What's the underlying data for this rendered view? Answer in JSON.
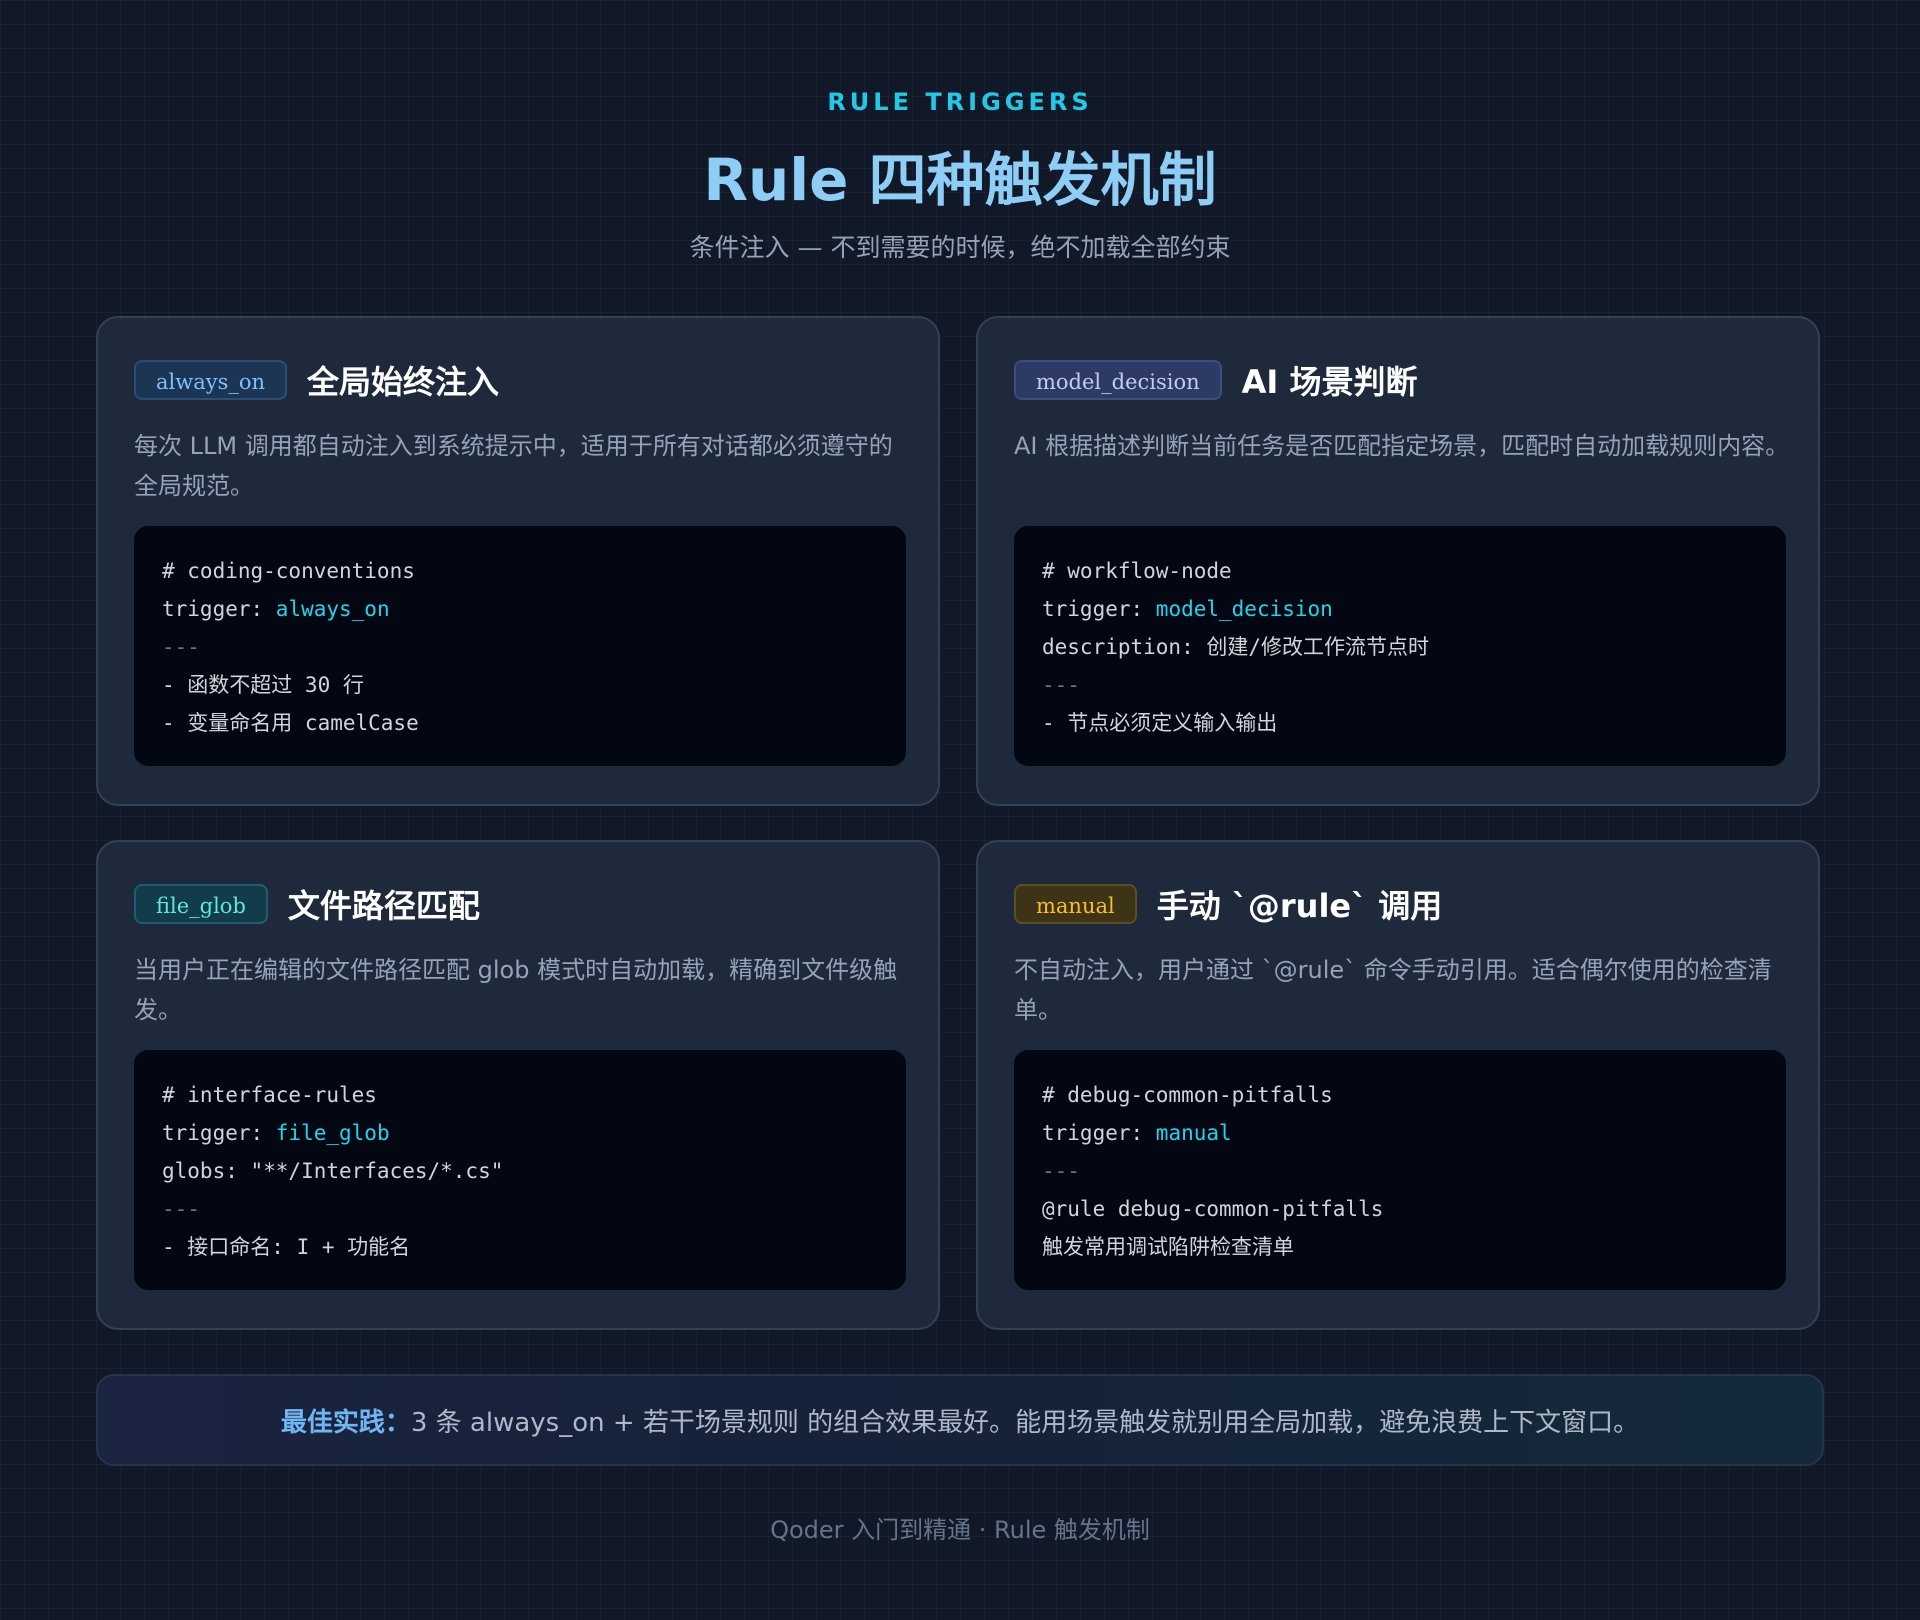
{
  "header": {
    "eyebrow": "RULE TRIGGERS",
    "title": "Rule 四种触发机制",
    "subtitle": "条件注入 — 不到需要的时候，绝不加载全部约束"
  },
  "cards": [
    {
      "tag": "always_on",
      "title": "全局始终注入",
      "desc": "每次 LLM 调用都自动注入到系统提示中，适用于所有对话都必须遵守的全局规范。",
      "code": {
        "line1": "# coding-conventions",
        "line2_key": "trigger: ",
        "line2_val": "always_on",
        "line3": "---",
        "line4": "- 函数不超过 30 行",
        "line5": "- 变量命名用 camelCase"
      }
    },
    {
      "tag": "model_decision",
      "title": "AI 场景判断",
      "desc": "AI 根据描述判断当前任务是否匹配指定场景，匹配时自动加载规则内容。",
      "code": {
        "line1": "# workflow-node",
        "line2_key": "trigger: ",
        "line2_val": "model_decision",
        "line3": "description: 创建/修改工作流节点时",
        "line4": "---",
        "line5": "- 节点必须定义输入输出"
      }
    },
    {
      "tag": "file_glob",
      "title": "文件路径匹配",
      "desc": "当用户正在编辑的文件路径匹配 glob 模式时自动加载，精确到文件级触发。",
      "code": {
        "line1": "# interface-rules",
        "line2_key": "trigger: ",
        "line2_val": "file_glob",
        "line3": "globs: \"**/Interfaces/*.cs\"",
        "line4": "---",
        "line5": "- 接口命名: I + 功能名"
      }
    },
    {
      "tag": "manual",
      "title": "手动 `@rule` 调用",
      "desc": "不自动注入，用户通过 `@rule` 命令手动引用。适合偶尔使用的检查清单。",
      "code": {
        "line1": "# debug-common-pitfalls",
        "line2_key": "trigger: ",
        "line2_val": "manual",
        "line3": "---",
        "line4": "@rule debug-common-pitfalls",
        "line5": "触发常用调试陷阱检查清单"
      }
    }
  ],
  "best_practice": {
    "label": "最佳实践：",
    "text": "3 条 always_on + 若干场景规则 的组合效果最好。能用场景触发就别用全局加载，避免浪费上下文窗口。"
  },
  "footer": "Qoder 入门到精通 · Rule 触发机制"
}
